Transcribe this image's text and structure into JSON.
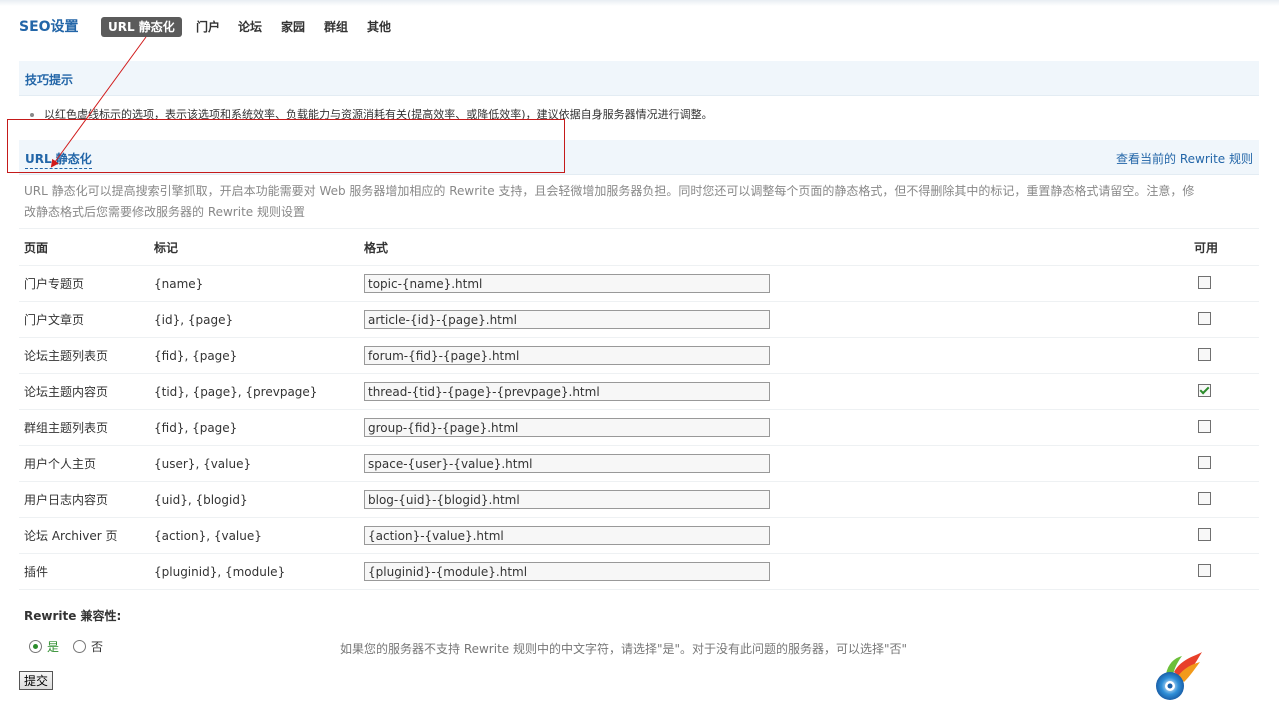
{
  "nav": {
    "title": "SEO设置",
    "tabs": [
      {
        "label": "URL 静态化",
        "active": true
      },
      {
        "label": "门户"
      },
      {
        "label": "论坛"
      },
      {
        "label": "家园"
      },
      {
        "label": "群组"
      },
      {
        "label": "其他"
      }
    ]
  },
  "tips": {
    "title": "技巧提示",
    "items": [
      "以红色虚线标示的选项，表示该选项和系统效率、负载能力与资源消耗有关(提高效率、或降低效率)，建议依据自身服务器情况进行调整。"
    ]
  },
  "section": {
    "title": "URL 静态化",
    "link": "查看当前的 Rewrite 规则",
    "description": "URL 静态化可以提高搜索引擎抓取，开启本功能需要对 Web 服务器增加相应的 Rewrite 支持，且会轻微增加服务器负担。同时您还可以调整每个页面的静态格式，但不得删除其中的标记，重置静态格式请留空。注意，修改静态格式后您需要修改服务器的 Rewrite 规则设置"
  },
  "table": {
    "headers": {
      "page": "页面",
      "mark": "标记",
      "format": "格式",
      "enabled": "可用"
    },
    "rows": [
      {
        "page": "门户专题页",
        "mark": "{name}",
        "format": "topic-{name}.html",
        "enabled": false
      },
      {
        "page": "门户文章页",
        "mark": "{id}, {page}",
        "format": "article-{id}-{page}.html",
        "enabled": false
      },
      {
        "page": "论坛主题列表页",
        "mark": "{fid}, {page}",
        "format": "forum-{fid}-{page}.html",
        "enabled": false
      },
      {
        "page": "论坛主题内容页",
        "mark": "{tid}, {page}, {prevpage}",
        "format": "thread-{tid}-{page}-{prevpage}.html",
        "enabled": true
      },
      {
        "page": "群组主题列表页",
        "mark": "{fid}, {page}",
        "format": "group-{fid}-{page}.html",
        "enabled": false
      },
      {
        "page": "用户个人主页",
        "mark": "{user}, {value}",
        "format": "space-{user}-{value}.html",
        "enabled": false
      },
      {
        "page": "用户日志内容页",
        "mark": "{uid}, {blogid}",
        "format": "blog-{uid}-{blogid}.html",
        "enabled": false
      },
      {
        "page": "论坛 Archiver 页",
        "mark": "{action}, {value}",
        "format": "{action}-{value}.html",
        "enabled": false
      },
      {
        "page": "插件",
        "mark": "{pluginid}, {module}",
        "format": "{pluginid}-{module}.html",
        "enabled": false
      }
    ]
  },
  "compat": {
    "label": "Rewrite 兼容性:",
    "yes_label": "是",
    "no_label": "否",
    "selected": "yes",
    "note": "如果您的服务器不支持 Rewrite 规则中的中文字符，请选择\"是\"。对于没有此问题的服务器，可以选择\"否\""
  },
  "submit_label": "提交",
  "colors": {
    "accent": "#2366a8",
    "annotation": "#d11a1a",
    "section_bg": "#f0f6fb",
    "check": "#2c8c2c"
  },
  "icons": {
    "logo": "discuz-logo-icon",
    "checkbox": "checkbox-icon",
    "radio": "radio-icon"
  }
}
